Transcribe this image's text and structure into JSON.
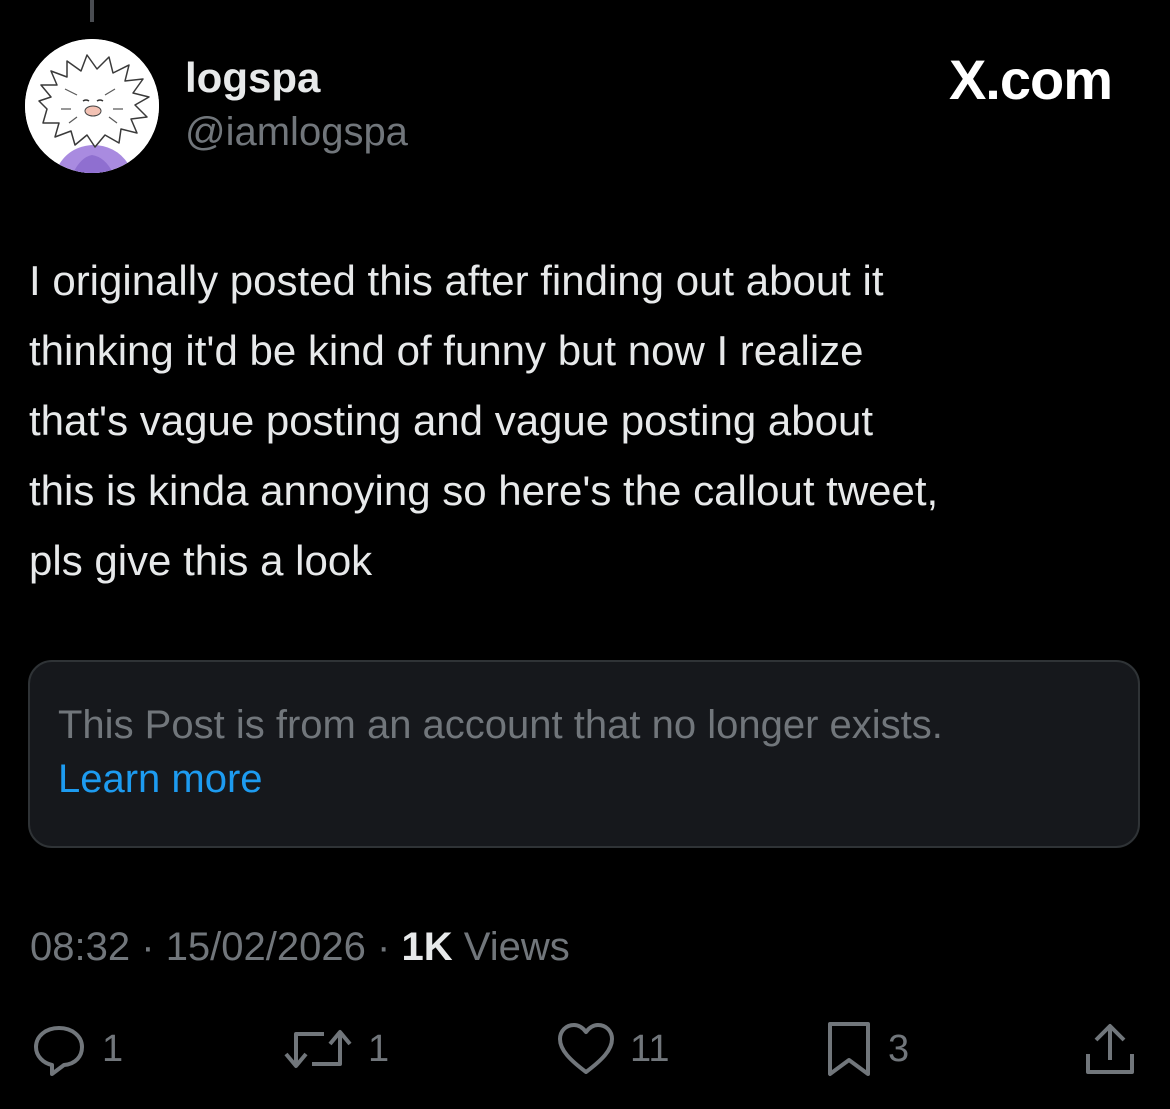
{
  "header": {
    "display_name": "logspa",
    "handle": "@iamlogspa",
    "brand": "X.com"
  },
  "post": {
    "text": "I originally posted this after finding out about it\nthinking it'd be kind of funny but now I realize\nthat's vague posting and vague posting about\nthis is kinda annoying so here's the callout tweet,\npls give this a look"
  },
  "quoted_notice": {
    "message": "This Post is from an account that no longer exists.",
    "link_label": "Learn more"
  },
  "meta": {
    "time": "08:32",
    "separator": "·",
    "date": "15/02/2026",
    "views_count": "1K",
    "views_label": "Views"
  },
  "actions": {
    "reply": {
      "icon": "reply-icon",
      "count": "1"
    },
    "repost": {
      "icon": "repost-icon",
      "count": "1"
    },
    "like": {
      "icon": "heart-icon",
      "count": "11"
    },
    "bookmark": {
      "icon": "bookmark-icon",
      "count": "3"
    },
    "share": {
      "icon": "share-icon"
    }
  },
  "colors": {
    "background": "#000000",
    "primary_text": "#e7e9ea",
    "secondary_text": "#71767b",
    "link": "#1d9bf0",
    "card_background": "#16181c",
    "card_border": "#2f3336"
  }
}
